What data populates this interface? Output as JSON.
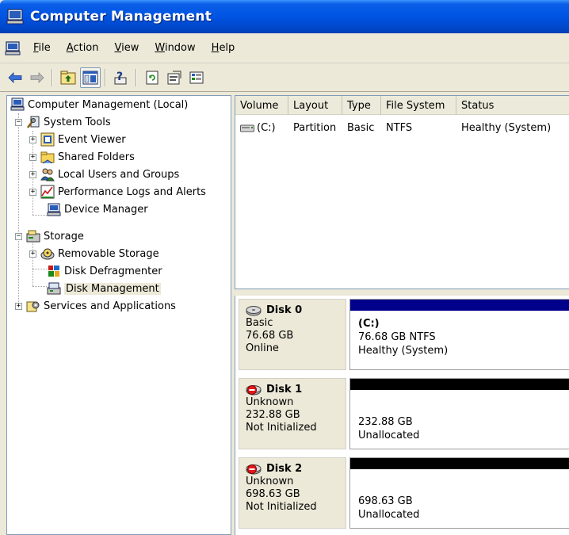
{
  "window": {
    "title": "Computer Management"
  },
  "menu": [
    {
      "label": "File",
      "u": "F",
      "rest": "ile"
    },
    {
      "label": "Action",
      "u": "A",
      "rest": "ction"
    },
    {
      "label": "View",
      "u": "V",
      "rest": "iew"
    },
    {
      "label": "Window",
      "u": "W",
      "rest": "indow"
    },
    {
      "label": "Help",
      "u": "H",
      "rest": "elp"
    }
  ],
  "toolbar": {
    "buttons": [
      "back-arrow-icon",
      "forward-arrow-icon",
      "up-folder-icon",
      "show-hide-tree-icon",
      "help-icon",
      "refresh-icon",
      "properties-icon",
      "export-list-icon"
    ]
  },
  "tree": {
    "root": "Computer Management (Local)",
    "system_tools": "System Tools",
    "event_viewer": "Event Viewer",
    "shared_folders": "Shared Folders",
    "local_users": "Local Users and Groups",
    "perf_logs": "Performance Logs and Alerts",
    "device_manager": "Device Manager",
    "storage": "Storage",
    "removable_storage": "Removable Storage",
    "disk_defrag": "Disk Defragmenter",
    "disk_management": "Disk Management",
    "services": "Services and Applications"
  },
  "volume_list": {
    "columns": [
      "Volume",
      "Layout",
      "Type",
      "File System",
      "Status"
    ],
    "rows": [
      {
        "volume": "(C:)",
        "layout": "Partition",
        "type": "Basic",
        "fs": "NTFS",
        "status": "Healthy (System)"
      }
    ]
  },
  "disks": [
    {
      "name": "Disk 0",
      "type": "Basic",
      "size": "76.68 GB",
      "state": "Online",
      "partition": {
        "volume": "(C:)",
        "line1": "76.68 GB NTFS",
        "line2": "Healthy (System)",
        "bar_color": "#00008b"
      }
    },
    {
      "name": "Disk 1",
      "type": "Unknown",
      "size": "232.88 GB",
      "state": "Not Initialized",
      "partition": {
        "volume": "",
        "line1": "232.88 GB",
        "line2": "Unallocated",
        "bar_color": "#000000"
      }
    },
    {
      "name": "Disk 2",
      "type": "Unknown",
      "size": "698.63 GB",
      "state": "Not Initialized",
      "partition": {
        "volume": "",
        "line1": "698.63 GB",
        "line2": "Unallocated",
        "bar_color": "#000000"
      }
    }
  ],
  "colors": {
    "titlebar": "#0054e3",
    "basic_partition": "#00008b",
    "unallocated": "#000000"
  }
}
